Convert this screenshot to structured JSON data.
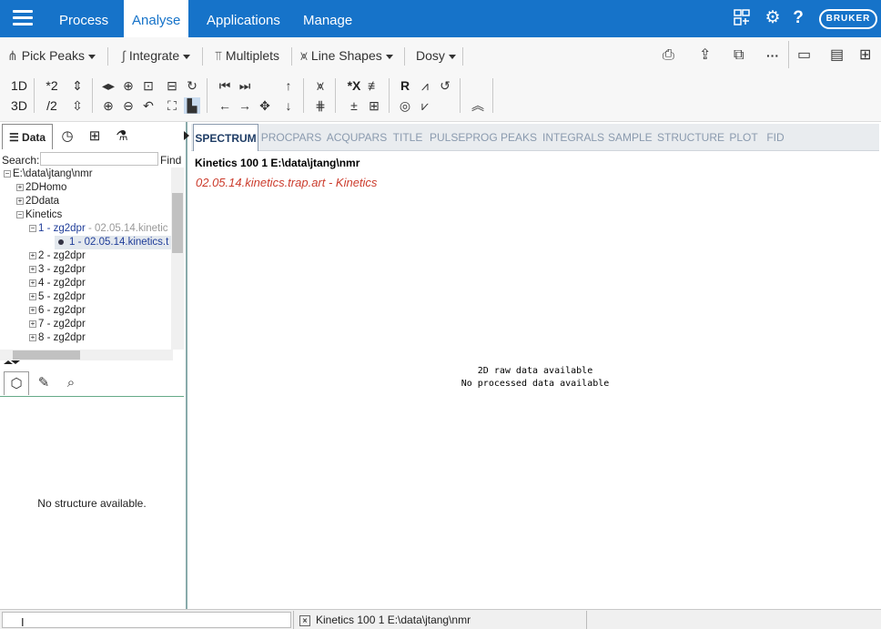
{
  "menubar": {
    "items": [
      "Process",
      "Analyse",
      "Applications",
      "Manage"
    ],
    "active": "Analyse",
    "brand": "BRUKER",
    "help": "?"
  },
  "toolbar": {
    "pick_peaks": "Pick Peaks",
    "integrate": "Integrate",
    "multiplets": "Multiplets",
    "line_shapes": "Line Shapes",
    "dosy": "Dosy"
  },
  "toolbar2": {
    "b1d": "1D",
    "b3d": "3D",
    "times2": "*2",
    "div2": "/2",
    "r_label": "R",
    "x_label": "*X"
  },
  "left": {
    "tab_data": "Data",
    "search_label": "Search:",
    "search_value": "",
    "find": "Find",
    "tree": [
      {
        "label": "E:\\data\\jtang\\nmr"
      },
      {
        "label": "2DHomo"
      },
      {
        "label": "2Ddata"
      },
      {
        "label": "Kinetics"
      },
      {
        "label": "1 - zg2dpr",
        "sub": " - 02.05.14.kinetic"
      },
      {
        "label": "1 - 02.05.14.kinetics.t"
      },
      {
        "label": "2 - zg2dpr"
      },
      {
        "label": "3 - zg2dpr"
      },
      {
        "label": "4 - zg2dpr"
      },
      {
        "label": "5 - zg2dpr"
      },
      {
        "label": "6 - zg2dpr"
      },
      {
        "label": "7 - zg2dpr"
      },
      {
        "label": "8 - zg2dpr"
      }
    ],
    "no_structure": "No structure available."
  },
  "main": {
    "tabs": [
      "SPECTRUM",
      "PROCPARS",
      "ACQUPARS",
      "TITLE",
      "PULSEPROG",
      "PEAKS",
      "INTEGRALS",
      "SAMPLE",
      "STRUCTURE",
      "PLOT",
      "FID"
    ],
    "active_tab": "SPECTRUM",
    "dataset_title": "Kinetics  100  1  E:\\data\\jtang\\nmr",
    "subtitle": "02.05.14.kinetics.trap.art - Kinetics",
    "msg1": "2D raw data available",
    "msg2": "No processed data available"
  },
  "status": {
    "dataset": "Kinetics  100  1  E:\\data\\jtang\\nmr"
  },
  "colors": {
    "accent": "#1673c9",
    "subtitle": "#cc3d2e"
  }
}
